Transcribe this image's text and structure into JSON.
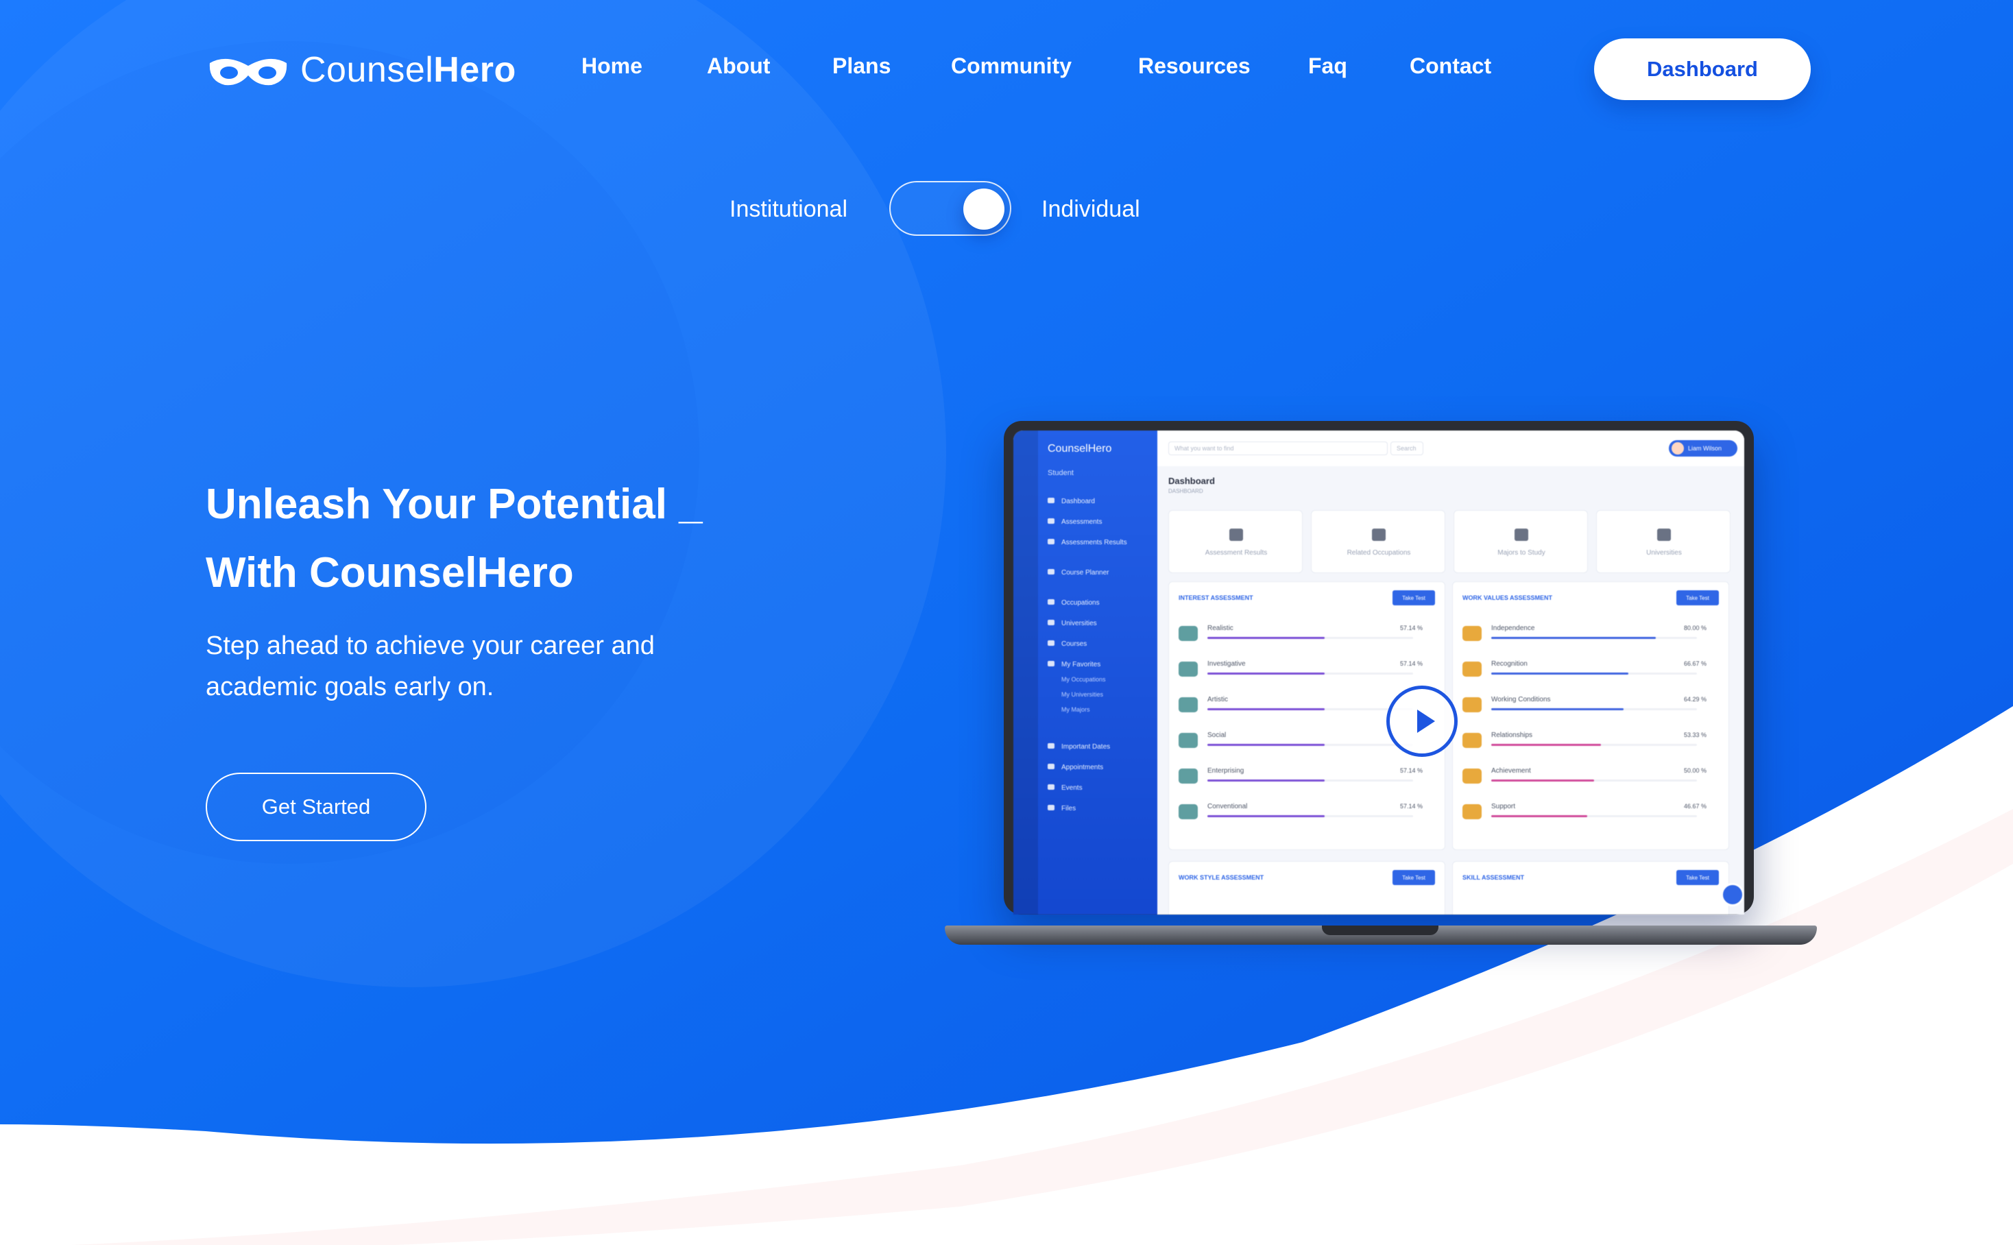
{
  "brand": {
    "name_light": "Counsel",
    "name_bold": "Hero",
    "accent": "#1466f0"
  },
  "nav": {
    "links": [
      "Home",
      "About",
      "Plans",
      "Community",
      "Resources",
      "Faq",
      "Contact"
    ],
    "dashboard_label": "Dashboard"
  },
  "toggle": {
    "left_label": "Institutional",
    "right_label": "Individual",
    "selected": "Individual"
  },
  "hero": {
    "title_line1": "Unleash Your Potential _",
    "title_line2": "With CounselHero",
    "subtitle_line1": "Step ahead to achieve your career and",
    "subtitle_line2": "academic goals early on.",
    "cta_label": "Get Started"
  },
  "preview": {
    "logo": "CounselHero",
    "role": "Student",
    "search_placeholder": "What you want to find",
    "search_button": "Search",
    "user_name": "Liam Wilson",
    "page_title": "Dashboard",
    "breadcrumb": "DASHBOARD",
    "sidebar": [
      "Dashboard",
      "Assessments",
      "Assessments Results",
      "Course Planner",
      "Occupations",
      "Universities",
      "Courses",
      "My Favorites",
      "Important Dates",
      "Appointments",
      "Events",
      "Files"
    ],
    "sidebar_sub": [
      "My Occupations",
      "My Universities",
      "My Majors"
    ],
    "stat_cards": [
      "Assessment Results",
      "Related Occupations",
      "Majors to Study",
      "Universities"
    ],
    "take_test": "Take Test",
    "interest": {
      "title": "INTEREST ASSESSMENT",
      "rows": [
        {
          "name": "Realistic",
          "value": "57.14 %",
          "fraction": 0.57
        },
        {
          "name": "Investigative",
          "value": "57.14 %",
          "fraction": 0.57
        },
        {
          "name": "Artistic",
          "value": "",
          "fraction": 0.57
        },
        {
          "name": "Social",
          "value": "",
          "fraction": 0.57
        },
        {
          "name": "Enterprising",
          "value": "57.14 %",
          "fraction": 0.57
        },
        {
          "name": "Conventional",
          "value": "57.14 %",
          "fraction": 0.57
        }
      ]
    },
    "work_values": {
      "title": "WORK VALUES ASSESSMENT",
      "rows": [
        {
          "name": "Independence",
          "value": "80.00 %",
          "fraction": 0.8
        },
        {
          "name": "Recognition",
          "value": "66.67 %",
          "fraction": 0.667
        },
        {
          "name": "Working Conditions",
          "value": "64.29 %",
          "fraction": 0.643
        },
        {
          "name": "Relationships",
          "value": "53.33 %",
          "fraction": 0.533
        },
        {
          "name": "Achievement",
          "value": "50.00 %",
          "fraction": 0.5
        },
        {
          "name": "Support",
          "value": "46.67 %",
          "fraction": 0.467
        }
      ]
    },
    "work_style_title": "WORK STYLE ASSESSMENT",
    "skill_title": "SKILL ASSESSMENT"
  }
}
